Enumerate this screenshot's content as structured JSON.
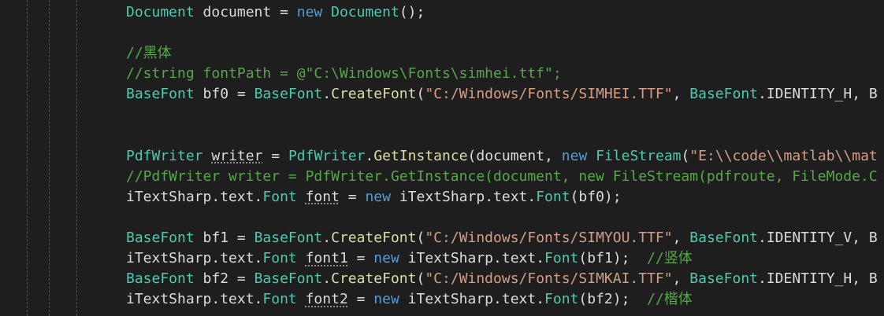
{
  "colors": {
    "background": "#1e1e1e",
    "type": "#4ec9b0",
    "keyword": "#569cd6",
    "method": "#dcdcaa",
    "string": "#d69d85",
    "comment": "#57a64a",
    "text": "#dcdcdc"
  },
  "code": {
    "l1": {
      "t1": "Document",
      "t2": " document = ",
      "kw": "new",
      "t3": " ",
      "ty2": "Document",
      "t4": "();"
    },
    "l3": {
      "cm": "//黑体"
    },
    "l4": {
      "cm": "//string fontPath = @\"C:\\Windows\\Fonts\\simhei.ttf\";"
    },
    "l5": {
      "ty1": "BaseFont",
      "t1": " bf0 = ",
      "ty2": "BaseFont",
      "t2": ".",
      "fn": "CreateFont",
      "t3": "(",
      "str": "\"C:/Windows/Fonts/SIMHEI.TTF\"",
      "t4": ", ",
      "ty3": "BaseFont",
      "t5": ".IDENTITY_H, B"
    },
    "l8": {
      "ty1": "PdfWriter",
      "t1": " ",
      "ul": "writer",
      "t2": " = ",
      "ty2": "PdfWriter",
      "t3": ".",
      "fn": "GetInstance",
      "t4": "(document, ",
      "kw": "new",
      "t5": " ",
      "ty3": "FileStream",
      "t6": "(",
      "str": "\"E:\\\\code\\\\matlab\\\\mat"
    },
    "l9": {
      "cm": "//PdfWriter writer = PdfWriter.GetInstance(document, new FileStream(pdfroute, FileMode.C"
    },
    "l10": {
      "t1": "iTextSharp.text.",
      "ty1": "Font",
      "t2": " ",
      "ul": "font",
      "t3": " = ",
      "kw": "new",
      "t4": " iTextSharp.text.",
      "ty2": "Font",
      "t5": "(bf0);"
    },
    "l12": {
      "ty1": "BaseFont",
      "t1": " bf1 = ",
      "ty2": "BaseFont",
      "t2": ".",
      "fn": "CreateFont",
      "t3": "(",
      "str": "\"C:/Windows/Fonts/SIMYOU.TTF\"",
      "t4": ", ",
      "ty3": "BaseFont",
      "t5": ".IDENTITY_V, B"
    },
    "l13": {
      "t1": "iTextSharp.text.",
      "ty1": "Font",
      "t2": " ",
      "ul": "font1",
      "t3": " = ",
      "kw": "new",
      "t4": " iTextSharp.text.",
      "ty2": "Font",
      "t5": "(bf1);  ",
      "cm": "//竖体"
    },
    "l14": {
      "ty1": "BaseFont",
      "t1": " bf2 = ",
      "ty2": "BaseFont",
      "t2": ".",
      "fn": "CreateFont",
      "t3": "(",
      "str": "\"C:/Windows/Fonts/SIMKAI.TTF\"",
      "t4": ", ",
      "ty3": "BaseFont",
      "t5": ".IDENTITY_H, B"
    },
    "l15": {
      "t1": "iTextSharp.text.",
      "ty1": "Font",
      "t2": " ",
      "ul": "font2",
      "t3": " = ",
      "kw": "new",
      "t4": " iTextSharp.text.",
      "ty2": "Font",
      "t5": "(bf2);  ",
      "cm": "//楷体"
    }
  }
}
